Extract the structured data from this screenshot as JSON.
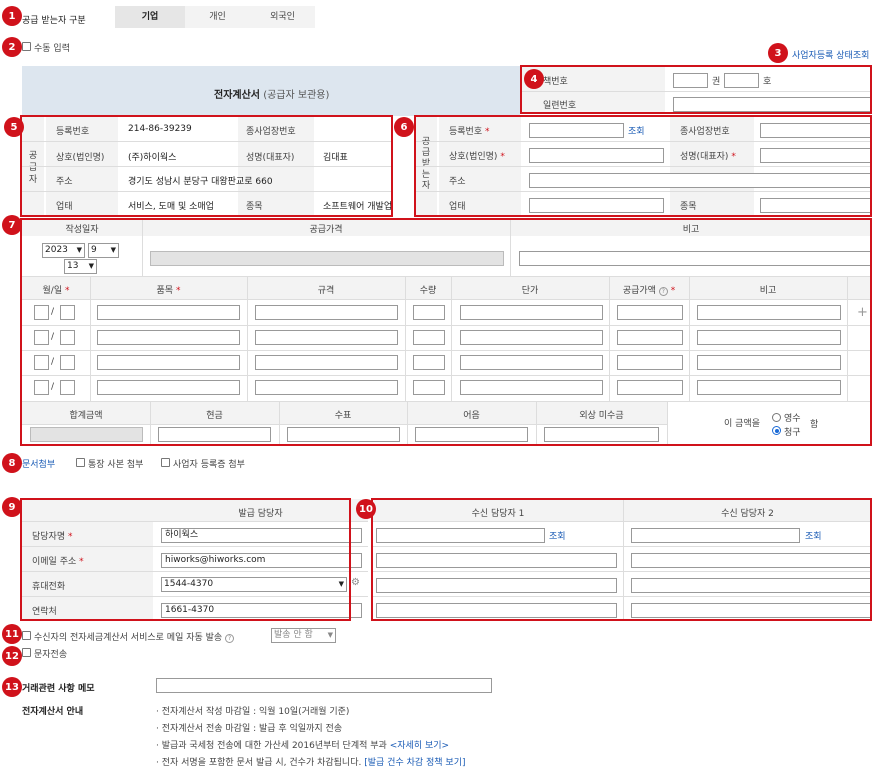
{
  "top": {
    "supply_type_label": "공급 받는자 구분",
    "tabs": [
      "기업",
      "개인",
      "외국인"
    ],
    "manual_input_label": "수동 입력",
    "status_link": "사업자등록 상태조회"
  },
  "invoice": {
    "title": "전자계산서",
    "subtitle": "(공급자 보관용)",
    "book_no_label": "책번호",
    "book_unit": "권",
    "no_unit": "호",
    "serial_label": "일련번호"
  },
  "supplier": {
    "side_label": "공급자",
    "reg_no_label": "등록번호",
    "reg_no": "214-86-39239",
    "branch_label": "종사업장번호",
    "company_label": "상호(법인명)",
    "company": "(주)하이웍스",
    "ceo_label": "성명(대표자)",
    "ceo": "김대표",
    "address_label": "주소",
    "address": "경기도 성남시 분당구 대왕판교로 660",
    "biz_type_label": "업태",
    "biz_type": "서비스, 도매 및 소매업",
    "item_label": "종목",
    "item": "소프트웨어 개발업"
  },
  "receiver": {
    "side_label": "공급받는자",
    "reg_no_label": "등록번호",
    "lookup": "조회",
    "branch_label": "종사업장번호",
    "company_label": "상호(법인명)",
    "ceo_label": "성명(대표자)",
    "address_label": "주소",
    "biz_type_label": "업태",
    "item_label": "종목"
  },
  "amounts": {
    "date_label": "작성일자",
    "supply_price_label": "공급가격",
    "note_label": "비고",
    "year": "2023",
    "month": "9",
    "day": "13",
    "item_headers": [
      "월/일",
      "품목",
      "규격",
      "수량",
      "단가",
      "공급가액",
      "비고"
    ],
    "row_count": 4,
    "totals_headers": [
      "합계금액",
      "현금",
      "수표",
      "어음",
      "외상 미수금"
    ],
    "amount_prefix": "이 금액을",
    "receipt": "영수",
    "claim": "청구",
    "amount_suffix": "함"
  },
  "attach": {
    "doc_attach": "문서첨부",
    "bankbook": "통장 사본 첨부",
    "biz_cert": "사업자 등록증 첨부"
  },
  "issuer": {
    "header": "발급 담당자",
    "name_label": "담당자명",
    "name": "하이웍스",
    "email_label": "이메일 주소",
    "email": "hiworks@hiworks.com",
    "mobile_label": "휴대전화",
    "mobile": "1544-4370",
    "phone_label": "연락처",
    "phone": "1661-4370"
  },
  "recipients": {
    "header1": "수신 담당자 1",
    "header2": "수신 담당자 2",
    "lookup": "조회"
  },
  "options": {
    "auto_mail": "수신자의 전자세금계산서 서비스로 메일 자동 발송",
    "auto_mail_select": "발송 안 함",
    "sms": "문자전송",
    "memo_label": "거래관련 사항 메모"
  },
  "guide": {
    "title": "전자계산서 안내",
    "lines": [
      "· 전자계산서 작성 마감일 : 익월 10일(거래월 기준)",
      "· 전자계산서 전송 마감일 : 발급 후 익일까지 전송",
      "· 발급과 국세청 전송에 대한 가산세 2016년부터 단계적 부과",
      "· 전자 서명을 포함한 문서 발급 시, 건수가 차감됩니다."
    ],
    "detail_link": "<자세히 보기>",
    "policy_link": "[발급 건수 차감 정책 보기]"
  },
  "badges": [
    "1",
    "2",
    "3",
    "4",
    "5",
    "6",
    "7",
    "8",
    "9",
    "10",
    "11",
    "12",
    "13"
  ]
}
